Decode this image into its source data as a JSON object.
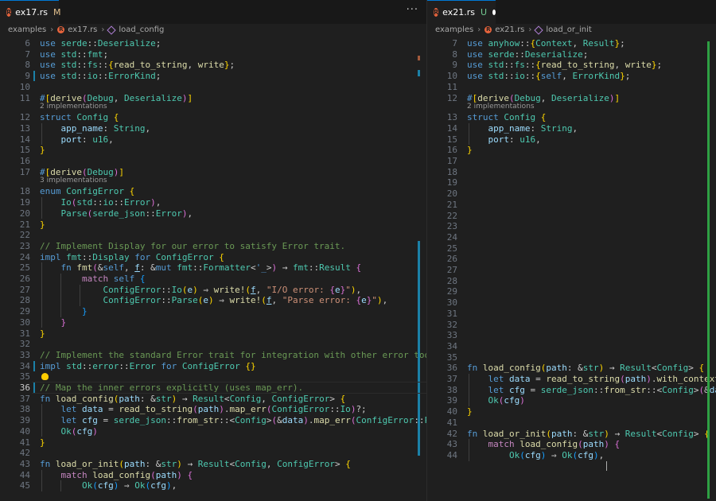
{
  "left": {
    "tab": {
      "name": "ex17.rs",
      "status": "M"
    },
    "more_actions": "···",
    "breadcrumbs": [
      "examples",
      "ex17.rs",
      "load_config"
    ],
    "lines": [
      {
        "n": "6",
        "c": "<span class=\"kw\">use</span> <span class=\"ty\">serde</span>::<span class=\"ty\">Deserialize</span>;"
      },
      {
        "n": "7",
        "c": "<span class=\"kw\">use</span> <span class=\"ty\">std</span>::<span class=\"ty\">fmt</span>;"
      },
      {
        "n": "8",
        "c": "<span class=\"kw\">use</span> <span class=\"ty\">std</span>::<span class=\"ty\">fs</span>::<span class=\"br1\">{</span><span class=\"fn\">read_to_string</span>, <span class=\"fn\">write</span><span class=\"br1\">}</span>;"
      },
      {
        "n": "9",
        "c": "<span class=\"kw\">use</span> <span class=\"ty\">std</span>::<span class=\"ty\">io</span>::<span class=\"ty\">ErrorKind</span>;"
      },
      {
        "n": "10",
        "c": ""
      },
      {
        "n": "11",
        "c": "<span class=\"ma\">#</span><span class=\"br1\">[</span><span class=\"fn\">derive</span><span class=\"br2\">(</span><span class=\"ty\">Debug</span>, <span class=\"ty\">Deserialize</span><span class=\"br2\">)</span><span class=\"br1\">]</span>",
        "lens": "2 implementations"
      },
      {
        "n": "12",
        "c": "<span class=\"kw\">struct</span> <span class=\"ty\">Config</span> <span class=\"br1\">{</span>"
      },
      {
        "n": "13",
        "c": "    <span class=\"va\">app_name</span>: <span class=\"ty\">String</span>,"
      },
      {
        "n": "14",
        "c": "    <span class=\"va\">port</span>: <span class=\"ty\">u16</span>,"
      },
      {
        "n": "15",
        "c": "<span class=\"br1\">}</span>"
      },
      {
        "n": "16",
        "c": ""
      },
      {
        "n": "17",
        "c": "<span class=\"ma\">#</span><span class=\"br1\">[</span><span class=\"fn\">derive</span><span class=\"br2\">(</span><span class=\"ty\">Debug</span><span class=\"br2\">)</span><span class=\"br1\">]</span>",
        "lens": "3 implementations"
      },
      {
        "n": "18",
        "c": "<span class=\"kw\">enum</span> <span class=\"ty\">ConfigError</span> <span class=\"br1\">{</span>"
      },
      {
        "n": "19",
        "c": "    <span class=\"ty\">Io</span><span class=\"br2\">(</span><span class=\"ty\">std</span>::<span class=\"ty\">io</span>::<span class=\"ty\">Error</span><span class=\"br2\">)</span>,"
      },
      {
        "n": "20",
        "c": "    <span class=\"ty\">Parse</span><span class=\"br2\">(</span><span class=\"ty\">serde_json</span>::<span class=\"ty\">Error</span><span class=\"br2\">)</span>,"
      },
      {
        "n": "21",
        "c": "<span class=\"br1\">}</span>"
      },
      {
        "n": "22",
        "c": ""
      },
      {
        "n": "23",
        "c": "<span class=\"cm\">// Implement Display for our error to satisfy Error trait.</span>"
      },
      {
        "n": "24",
        "c": "<span class=\"kw\">impl</span> <span class=\"ty\">fmt</span>::<span class=\"ty\">Display</span> <span class=\"kw\">for</span> <span class=\"ty\">ConfigError</span> <span class=\"br1\">{</span>"
      },
      {
        "n": "25",
        "c": "    <span class=\"kw\">fn</span> <span class=\"fn\">fmt</span><span class=\"br2\">(</span>&amp;<span class=\"kw\">self</span>, <span class=\"va ul\">f</span>: &amp;<span class=\"kw\">mut</span> <span class=\"ty\">fmt</span>::<span class=\"ty\">Formatter</span>&lt;<span class=\"kw\">'_</span>&gt;<span class=\"br2\">)</span> <span class=\"pu\">→</span> <span class=\"ty\">fmt</span>::<span class=\"ty\">Result</span> <span class=\"br2\">{</span>"
      },
      {
        "n": "26",
        "c": "        <span class=\"ctl\">match</span> <span class=\"kw\">self</span> <span class=\"br3\">{</span>"
      },
      {
        "n": "27",
        "c": "            <span class=\"ty\">ConfigError</span>::<span class=\"ty\">Io</span><span class=\"br1\">(</span><span class=\"va\">e</span><span class=\"br1\">)</span> <span class=\"pu\">⇒</span> <span class=\"fn\">write!</span><span class=\"br1\">(</span><span class=\"va ul\">f</span>, <span class=\"st\">\"I/O error: </span><span class=\"br2\">{</span><span class=\"va\">e</span><span class=\"br2\">}</span><span class=\"st\">\"</span><span class=\"br1\">)</span>,"
      },
      {
        "n": "28",
        "c": "            <span class=\"ty\">ConfigError</span>::<span class=\"ty\">Parse</span><span class=\"br1\">(</span><span class=\"va\">e</span><span class=\"br1\">)</span> <span class=\"pu\">⇒</span> <span class=\"fn\">write!</span><span class=\"br1\">(</span><span class=\"va ul\">f</span>, <span class=\"st\">\"Parse error: </span><span class=\"br2\">{</span><span class=\"va\">e</span><span class=\"br2\">}</span><span class=\"st\">\"</span><span class=\"br1\">)</span>,"
      },
      {
        "n": "29",
        "c": "        <span class=\"br3\">}</span>"
      },
      {
        "n": "30",
        "c": "    <span class=\"br2\">}</span>"
      },
      {
        "n": "31",
        "c": "<span class=\"br1\">}</span>"
      },
      {
        "n": "32",
        "c": ""
      },
      {
        "n": "33",
        "c": "<span class=\"cm\">// Implement the standard Error trait for integration with other error tooling.</span>"
      },
      {
        "n": "34",
        "c": "<span class=\"kw\">impl</span> <span class=\"ty\">std</span>::<span class=\"ty\">error</span>::<span class=\"ty\">Error</span> <span class=\"kw\">for</span> <span class=\"ty\">ConfigError</span> <span class=\"br1\">{}</span>"
      },
      {
        "n": "35",
        "c": ""
      },
      {
        "n": "36",
        "c": "<span class=\"cm\">// Map the inner errors explicitly (uses map_err).</span>"
      },
      {
        "n": "37",
        "c": "<span class=\"kw\">fn</span> <span class=\"fn\">load_config</span><span class=\"br1\">(</span><span class=\"va\">path</span>: &amp;<span class=\"ty\">str</span><span class=\"br1\">)</span> <span class=\"pu\">→</span> <span class=\"ty\">Result</span>&lt;<span class=\"ty\">Config</span>, <span class=\"ty\">ConfigError</span>&gt; <span class=\"br1\">{</span>"
      },
      {
        "n": "38",
        "c": "    <span class=\"kw\">let</span> <span class=\"va\">data</span> = <span class=\"fn\">read_to_string</span><span class=\"br2\">(</span><span class=\"va\">path</span><span class=\"br2\">)</span>.<span class=\"fn\">map_err</span><span class=\"br2\">(</span><span class=\"ty\">ConfigError</span>::<span class=\"ty\">Io</span><span class=\"br2\">)</span>?;"
      },
      {
        "n": "39",
        "c": "    <span class=\"kw\">let</span> <span class=\"va\">cfg</span> = <span class=\"ty\">serde_json</span>::<span class=\"fn\">from_str</span>::&lt;<span class=\"ty\">Config</span>&gt;<span class=\"br2\">(</span>&amp;<span class=\"va\">data</span><span class=\"br2\">)</span>.<span class=\"fn\">map_err</span><span class=\"br2\">(</span><span class=\"ty\">ConfigError</span>::<span class=\"ty\">Parse</span><span class=\"br2\">)</span>"
      },
      {
        "n": "40",
        "c": "    <span class=\"ty\">Ok</span><span class=\"br2\">(</span><span class=\"va\">cfg</span><span class=\"br2\">)</span>"
      },
      {
        "n": "41",
        "c": "<span class=\"br1\">}</span>"
      },
      {
        "n": "42",
        "c": ""
      },
      {
        "n": "43",
        "c": "<span class=\"kw\">fn</span> <span class=\"fn\">load_or_init</span><span class=\"br1\">(</span><span class=\"va\">path</span>: &amp;<span class=\"ty\">str</span><span class=\"br1\">)</span> <span class=\"pu\">→</span> <span class=\"ty\">Result</span>&lt;<span class=\"ty\">Config</span>, <span class=\"ty\">ConfigError</span>&gt; <span class=\"br1\">{</span>"
      },
      {
        "n": "44",
        "c": "    <span class=\"ctl\">match</span> <span class=\"fn\">load_config</span><span class=\"br2\">(</span><span class=\"va\">path</span><span class=\"br2\">)</span> <span class=\"br2\">{</span>"
      },
      {
        "n": "45",
        "c": "        <span class=\"ty\">Ok</span><span class=\"br3\">(</span><span class=\"va\">cfg</span><span class=\"br3\">)</span> <span class=\"pu\">⇒</span> <span class=\"ty\">Ok</span><span class=\"br3\">(</span><span class=\"va\">cfg</span><span class=\"br3\">)</span>,"
      }
    ]
  },
  "right": {
    "tab": {
      "name": "ex21.rs",
      "status": "U"
    },
    "breadcrumbs": [
      "examples",
      "ex21.rs",
      "load_or_init"
    ],
    "lines": [
      {
        "n": "7",
        "c": "<span class=\"kw\">use</span> <span class=\"ty\">anyhow</span>::<span class=\"br1\">{</span><span class=\"ty\">Context</span>, <span class=\"ty\">Result</span><span class=\"br1\">}</span>;"
      },
      {
        "n": "8",
        "c": "<span class=\"kw\">use</span> <span class=\"ty\">serde</span>::<span class=\"ty\">Deserialize</span>;"
      },
      {
        "n": "9",
        "c": "<span class=\"kw\">use</span> <span class=\"ty\">std</span>::<span class=\"ty\">fs</span>::<span class=\"br1\">{</span><span class=\"fn\">read_to_string</span>, <span class=\"fn\">write</span><span class=\"br1\">}</span>;"
      },
      {
        "n": "10",
        "c": "<span class=\"kw\">use</span> <span class=\"ty\">std</span>::<span class=\"ty\">io</span>::<span class=\"br1\">{</span><span class=\"kw\">self</span>, <span class=\"ty\">ErrorKind</span><span class=\"br1\">}</span>;"
      },
      {
        "n": "11",
        "c": ""
      },
      {
        "n": "12",
        "c": "<span class=\"ma\">#</span><span class=\"br1\">[</span><span class=\"fn\">derive</span><span class=\"br2\">(</span><span class=\"ty\">Debug</span>, <span class=\"ty\">Deserialize</span><span class=\"br2\">)</span><span class=\"br1\">]</span>",
        "lens": "2 implementations"
      },
      {
        "n": "13",
        "c": "<span class=\"kw\">struct</span> <span class=\"ty\">Config</span> <span class=\"br1\">{</span>"
      },
      {
        "n": "14",
        "c": "    <span class=\"va\">app_name</span>: <span class=\"ty\">String</span>,"
      },
      {
        "n": "15",
        "c": "    <span class=\"va\">port</span>: <span class=\"ty\">u16</span>,"
      },
      {
        "n": "16",
        "c": "<span class=\"br1\">}</span>"
      },
      {
        "n": "17",
        "c": ""
      },
      {
        "n": "18",
        "c": ""
      },
      {
        "n": "19",
        "c": ""
      },
      {
        "n": "20",
        "c": ""
      },
      {
        "n": "21",
        "c": ""
      },
      {
        "n": "22",
        "c": ""
      },
      {
        "n": "23",
        "c": ""
      },
      {
        "n": "24",
        "c": ""
      },
      {
        "n": "25",
        "c": ""
      },
      {
        "n": "26",
        "c": ""
      },
      {
        "n": "27",
        "c": ""
      },
      {
        "n": "28",
        "c": ""
      },
      {
        "n": "29",
        "c": ""
      },
      {
        "n": "30",
        "c": ""
      },
      {
        "n": "31",
        "c": ""
      },
      {
        "n": "32",
        "c": ""
      },
      {
        "n": "33",
        "c": ""
      },
      {
        "n": "34",
        "c": ""
      },
      {
        "n": "35",
        "c": ""
      },
      {
        "n": "36",
        "c": "<span class=\"kw\">fn</span> <span class=\"fn\">load_config</span><span class=\"br1\">(</span><span class=\"va\">path</span>: &amp;<span class=\"ty\">str</span><span class=\"br1\">)</span> <span class=\"pu\">→</span> <span class=\"ty\">Result</span>&lt;<span class=\"ty\">Config</span>&gt; <span class=\"br1\">{</span>"
      },
      {
        "n": "37",
        "c": "    <span class=\"kw\">let</span> <span class=\"va\">data</span> = <span class=\"fn\">read_to_string</span><span class=\"br2\">(</span><span class=\"va\">path</span><span class=\"br2\">)</span>.<span class=\"fn\">with_context</span><span class=\"br2\">(</span><span class=\"br3\">||</span>"
      },
      {
        "n": "38",
        "c": "    <span class=\"kw\">let</span> <span class=\"va\">cfg</span> = <span class=\"ty\">serde_json</span>::<span class=\"fn\">from_str</span>::&lt;<span class=\"ty\">Config</span>&gt;<span class=\"br2\">(</span>&amp;<span class=\"va\">data</span><span class=\"br2\">)</span>"
      },
      {
        "n": "39",
        "c": "    <span class=\"ty\">Ok</span><span class=\"br2\">(</span><span class=\"va\">cfg</span><span class=\"br2\">)</span>"
      },
      {
        "n": "40",
        "c": "<span class=\"br1\">}</span>"
      },
      {
        "n": "41",
        "c": ""
      },
      {
        "n": "42",
        "c": "<span class=\"kw\">fn</span> <span class=\"fn\">load_or_init</span><span class=\"br1\">(</span><span class=\"va\">path</span>: &amp;<span class=\"ty\">str</span><span class=\"br1\">)</span> <span class=\"pu\">→</span> <span class=\"ty\">Result</span>&lt;<span class=\"ty\">Config</span>&gt; <span class=\"br1\">{</span>"
      },
      {
        "n": "43",
        "c": "    <span class=\"ctl\">match</span> <span class=\"fn\">load_config</span><span class=\"br2\">(</span><span class=\"va\">path</span><span class=\"br2\">)</span> <span class=\"br2\">{</span>"
      },
      {
        "n": "44",
        "c": "        <span class=\"ty\">Ok</span><span class=\"br3\">(</span><span class=\"va\">cfg</span><span class=\"br3\">)</span> <span class=\"pu\">⇒</span> <span class=\"ty\">Ok</span><span class=\"br3\">(</span><span class=\"va\">cfg</span><span class=\"br3\">)</span>,"
      }
    ]
  },
  "colors": {
    "accent": "#0078d4",
    "modified": "#e2c08d",
    "untracked": "#73c991",
    "gutter_added": "#2ea043",
    "gutter_modified": "#1b81a8"
  }
}
